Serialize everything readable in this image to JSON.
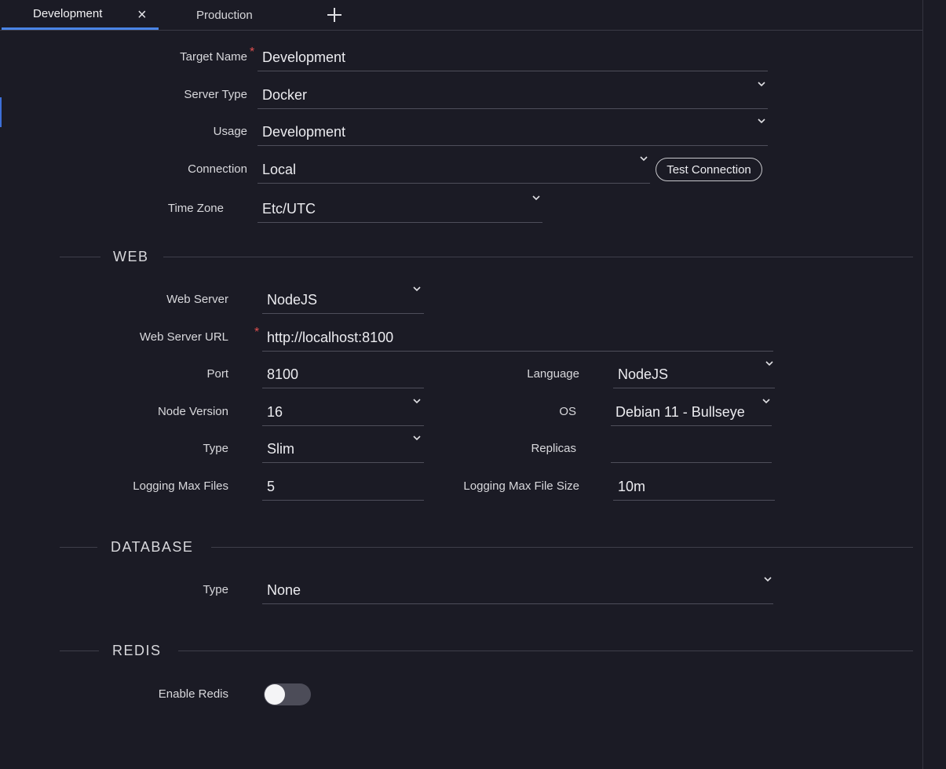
{
  "tabs": [
    {
      "label": "Development",
      "active": true,
      "closable": true
    },
    {
      "label": "Production",
      "active": false,
      "closable": false
    }
  ],
  "general": {
    "target_name": {
      "label": "Target Name",
      "value": "Development",
      "required": true
    },
    "server_type": {
      "label": "Server Type",
      "value": "Docker"
    },
    "usage": {
      "label": "Usage",
      "value": "Development"
    },
    "connection": {
      "label": "Connection",
      "value": "Local",
      "button": "Test Connection"
    },
    "time_zone": {
      "label": "Time Zone",
      "value": "Etc/UTC"
    }
  },
  "web": {
    "title": "WEB",
    "web_server": {
      "label": "Web Server",
      "value": "NodeJS"
    },
    "web_server_url": {
      "label": "Web Server URL",
      "value": "http://localhost:8100",
      "required": true
    },
    "port": {
      "label": "Port",
      "value": "8100"
    },
    "language": {
      "label": "Language",
      "value": "NodeJS"
    },
    "node_version": {
      "label": "Node Version",
      "value": "16"
    },
    "os": {
      "label": "OS",
      "value": "Debian 11 - Bullseye"
    },
    "type": {
      "label": "Type",
      "value": "Slim"
    },
    "replicas": {
      "label": "Replicas",
      "value": ""
    },
    "logging_max_files": {
      "label": "Logging Max Files",
      "value": "5"
    },
    "logging_max_file_size": {
      "label": "Logging Max File Size",
      "value": "10m"
    }
  },
  "database": {
    "title": "DATABASE",
    "type": {
      "label": "Type",
      "value": "None"
    }
  },
  "redis": {
    "title": "REDIS",
    "enable": {
      "label": "Enable Redis",
      "enabled": false
    }
  },
  "colors": {
    "background": "#1b1b25",
    "accent": "#4a84e6",
    "required": "#e05050",
    "toggle_off": "#4c4c58"
  }
}
